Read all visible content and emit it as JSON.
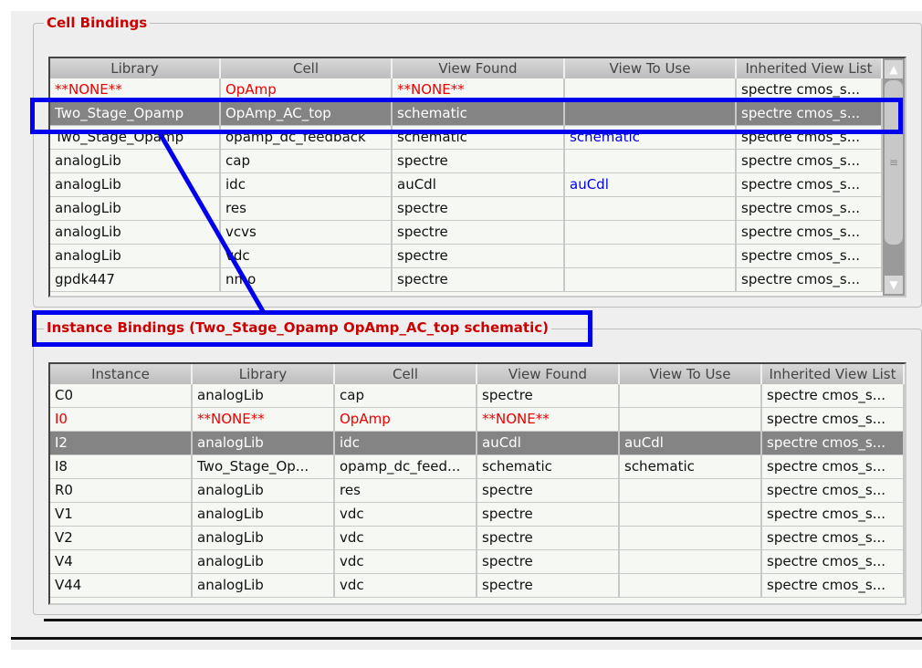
{
  "cell_bindings": {
    "title": "Cell Bindings",
    "columns": [
      "Library",
      "Cell",
      "View Found",
      "View To Use",
      "Inherited View List"
    ],
    "rows": [
      {
        "cells": [
          "**NONE**",
          "OpAmp",
          "**NONE**",
          "",
          "spectre cmos_s..."
        ],
        "unbound": true
      },
      {
        "cells": [
          "Two_Stage_Opamp",
          "OpAmp_AC_top",
          "schematic",
          "",
          "spectre cmos_s..."
        ],
        "selected": true
      },
      {
        "cells": [
          "Two_Stage_Opamp",
          "opamp_dc_feedback",
          "schematic",
          "schematic",
          "spectre cmos_s..."
        ],
        "override": true
      },
      {
        "cells": [
          "analogLib",
          "cap",
          "spectre",
          "",
          "spectre cmos_s..."
        ]
      },
      {
        "cells": [
          "analogLib",
          "idc",
          "auCdl",
          "auCdl",
          "spectre cmos_s..."
        ],
        "override": true
      },
      {
        "cells": [
          "analogLib",
          "res",
          "spectre",
          "",
          "spectre cmos_s..."
        ]
      },
      {
        "cells": [
          "analogLib",
          "vcvs",
          "spectre",
          "",
          "spectre cmos_s..."
        ]
      },
      {
        "cells": [
          "analogLib",
          "vdc",
          "spectre",
          "",
          "spectre cmos_s..."
        ]
      },
      {
        "cells": [
          "gpdk447",
          "nmo",
          "spectre",
          "",
          "spectre cmos_s..."
        ]
      }
    ]
  },
  "instance_bindings": {
    "title": "Instance Bindings (Two_Stage_Opamp OpAmp_AC_top schematic)",
    "columns": [
      "Instance",
      "Library",
      "Cell",
      "View Found",
      "View To Use",
      "Inherited View List"
    ],
    "rows": [
      {
        "cells": [
          "C0",
          "analogLib",
          "cap",
          "spectre",
          "",
          "spectre cmos_s..."
        ]
      },
      {
        "cells": [
          "I0",
          "**NONE**",
          "OpAmp",
          "**NONE**",
          "",
          "spectre cmos_s..."
        ],
        "unbound": true
      },
      {
        "cells": [
          "I2",
          "analogLib",
          "idc",
          "auCdl",
          "auCdl",
          "spectre cmos_s..."
        ],
        "selected": true
      },
      {
        "cells": [
          "I8",
          "Two_Stage_Op...",
          "opamp_dc_feed...",
          "schematic",
          "schematic",
          "spectre cmos_s..."
        ]
      },
      {
        "cells": [
          "R0",
          "analogLib",
          "res",
          "spectre",
          "",
          "spectre cmos_s..."
        ]
      },
      {
        "cells": [
          "V1",
          "analogLib",
          "vdc",
          "spectre",
          "",
          "spectre cmos_s..."
        ]
      },
      {
        "cells": [
          "V2",
          "analogLib",
          "vdc",
          "spectre",
          "",
          "spectre cmos_s..."
        ]
      },
      {
        "cells": [
          "V4",
          "analogLib",
          "vdc",
          "spectre",
          "",
          "spectre cmos_s..."
        ]
      },
      {
        "cells": [
          "V44",
          "analogLib",
          "vdc",
          "spectre",
          "",
          "spectre cmos_s..."
        ]
      }
    ]
  },
  "colors": {
    "legend": "#cc0000",
    "unbound": "#ee0000",
    "override": "#0000ee",
    "annotation": "#0000ee",
    "selected_row": "#848484"
  },
  "scrollbar": {
    "up_icon": "triangle-up-icon",
    "down_icon": "triangle-down-icon",
    "grip_icon": "grip-lines-icon"
  }
}
